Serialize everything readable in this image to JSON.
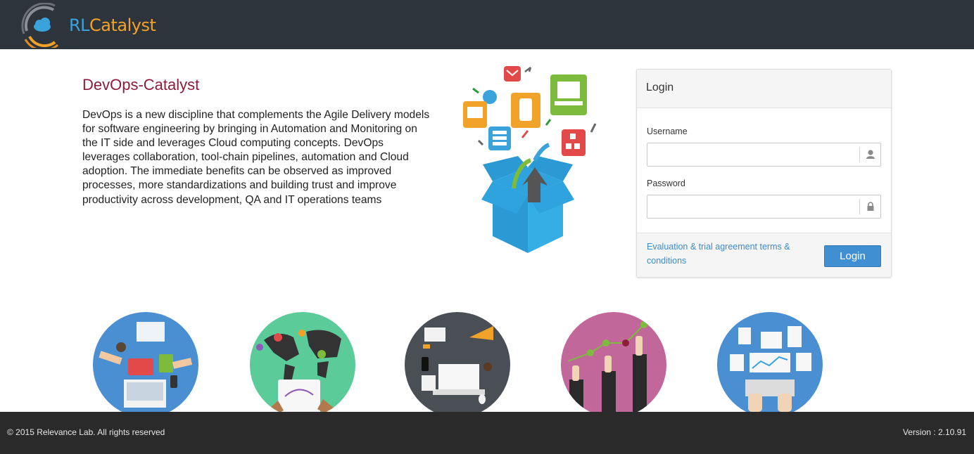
{
  "brand": {
    "name_part1": "RL",
    "name_part2": "Catalyst"
  },
  "intro": {
    "title": "DevOps-Catalyst",
    "description": "DevOps is a new discipline that complements the Agile Delivery models for software engineering by bringing in Automation and Monitoring on the IT side and leverages Cloud computing concepts. DevOps leverages collaboration, tool-chain pipelines, automation and Cloud adoption. The immediate benefits can be observed as improved processes, more standardizations and building trust and improve productivity across development, QA and IT operations teams"
  },
  "login": {
    "heading": "Login",
    "username_label": "Username",
    "username_value": "",
    "username_icon": "user-icon",
    "password_label": "Password",
    "password_value": "",
    "password_icon": "lock-icon",
    "terms_link": "Evaluation & trial agreement terms & conditions",
    "submit_label": "Login"
  },
  "illustrations": [
    {
      "name": "collaboration-illustration",
      "color": "#4a8fd1"
    },
    {
      "name": "world-map-illustration",
      "color": "#5ccb9a"
    },
    {
      "name": "workspace-illustration",
      "color": "#4a4e55"
    },
    {
      "name": "growth-chart-illustration",
      "color": "#c1679a"
    },
    {
      "name": "analytics-illustration",
      "color": "#4a8fd1"
    }
  ],
  "footer": {
    "copyright": "© 2015 Relevance Lab. All rights reserved",
    "version": "Version : 2.10.91"
  },
  "colors": {
    "topbar": "#2d343b",
    "title_accent": "#8e1c3a",
    "primary_button": "#3f8fd2",
    "link": "#3b8bd0",
    "footer": "#2a2a2a"
  }
}
